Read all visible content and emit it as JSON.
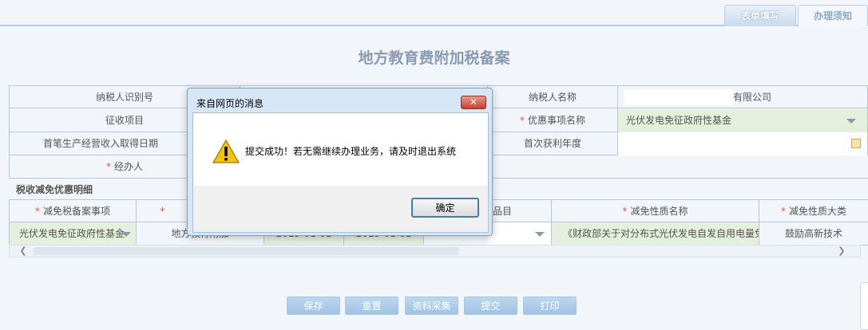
{
  "tabs": [
    {
      "label": "表单填写"
    },
    {
      "label": "办理须知"
    }
  ],
  "title": "地方教育费附加税备案",
  "form": {
    "taxpayer_id_label": "纳税人识别号",
    "taxpayer_name_label": "纳税人名称",
    "taxpayer_name_value": "有限公司",
    "levy_item_label": "征收项目",
    "preferential_item_label": "优惠事项名称",
    "preferential_item_value": "光伏发电免征政府性基金",
    "first_income_date_label": "首笔生产经营收入取得日期",
    "first_profit_year_label": "首次获利年度",
    "handler_label": "经办人",
    "required_mark": "*"
  },
  "detail": {
    "section_label": "税收减免优惠明细",
    "headers": [
      "减免税备案事项",
      "",
      "",
      "",
      "品目",
      "减免性质名称",
      "减免性质大类"
    ],
    "row": {
      "item": "光伏发电免征政府性基金",
      "levy": "地方教育附加",
      "date_from": "2019-01-01",
      "date_to": "2019-01-01",
      "nature_name": "《财政部关于对分布式光伏发电自发自用电量免",
      "nature_category": "鼓励高新技术"
    }
  },
  "buttons": [
    "保存",
    "重置",
    "资料采集",
    "提交",
    "打印"
  ],
  "dialog": {
    "title": "来自网页的消息",
    "close_label": "✕",
    "message": "提交成功！若无需继续办理业务，请及时退出系统",
    "ok_label": "确定"
  },
  "scroll": {
    "left_arrow": "❮",
    "right_arrow": "❯"
  }
}
